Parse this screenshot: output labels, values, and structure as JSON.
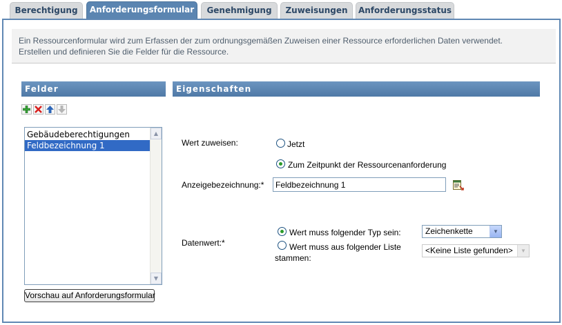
{
  "tabs": [
    {
      "label": "Berechtigung",
      "active": false
    },
    {
      "label": "Anforderungsformular",
      "active": true
    },
    {
      "label": "Genehmigung",
      "active": false
    },
    {
      "label": "Zuweisungen",
      "active": false
    },
    {
      "label": "Anforderungsstatus",
      "active": false
    }
  ],
  "description": {
    "line1": "Ein Ressourcenformular wird zum Erfassen der zum ordnungsgemäßen Zuweisen einer Ressource erforderlichen Daten verwendet.",
    "line2": "Erstellen und definieren Sie die Felder für die Ressource."
  },
  "fields_panel": {
    "header": "Felder",
    "toolbar": {
      "add_icon": "add-icon",
      "delete_icon": "delete-icon",
      "up_icon": "move-up-icon",
      "down_icon": "move-down-icon"
    },
    "items": [
      {
        "label": "Gebäudeberechtigungen",
        "selected": false
      },
      {
        "label": "Feldbezeichnung 1",
        "selected": true
      }
    ],
    "preview_button": "Vorschau auf Anforderungsformular"
  },
  "properties_panel": {
    "header": "Eigenschaften",
    "assign_value": {
      "label": "Wert zuweisen:",
      "option_now": "Jetzt",
      "option_request": "Zum Zeitpunkt der Ressourcenanforderung",
      "selected": "request"
    },
    "display_label": {
      "label": "Anzeigebezeichnung:*",
      "value": "Feldbezeichnung 1",
      "icon": "localize-icon"
    },
    "data_value": {
      "label": "Datenwert:*",
      "option_type": "Wert muss folgender Typ sein:",
      "option_list_line1": "Wert muss aus folgender Liste",
      "option_list_line2": "stammen:",
      "type_value": "Zeichenkette",
      "list_value": "<Keine Liste gefunden>",
      "selected": "type"
    }
  },
  "colors": {
    "tab_active": "#5b85b1",
    "header_bar": "#5a84b0",
    "frame_border": "#5f87b3",
    "selection": "#316ac5"
  }
}
